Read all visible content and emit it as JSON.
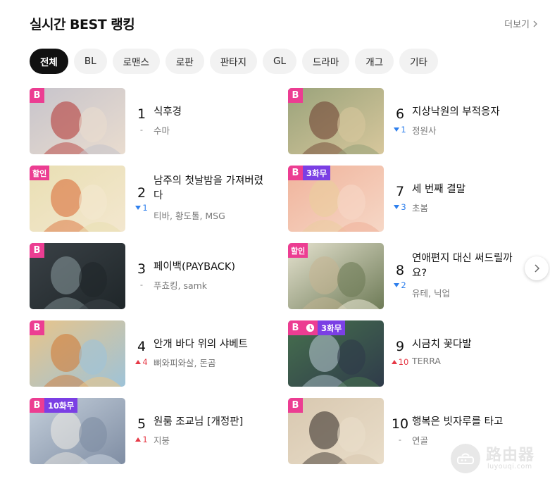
{
  "header": {
    "title": "실시간 BEST 랭킹",
    "more_label": "더보기"
  },
  "tabs": [
    "전체",
    "BL",
    "로맨스",
    "로판",
    "판타지",
    "GL",
    "드라마",
    "개그",
    "기타"
  ],
  "ranking": [
    {
      "rank": "1",
      "title_l1": "식후경",
      "title_l2": "",
      "authors": "수마",
      "change_dir": "same",
      "change": "-",
      "badges": [
        "B"
      ],
      "colors": [
        "#c7c4cb",
        "#b3302e",
        "#e9dccf"
      ]
    },
    {
      "rank": "2",
      "title_l1": "남주의 첫날밤을 가져버렸",
      "title_l2": "다",
      "authors": "티바, 황도톨, MSG",
      "change_dir": "down",
      "change": "1",
      "badges": [
        "할인"
      ],
      "colors": [
        "#e9dfb3",
        "#d9652e",
        "#f3e7cf"
      ]
    },
    {
      "rank": "3",
      "title_l1": "페이백(PAYBACK)",
      "title_l2": "",
      "authors": "푸쵸킹, samk",
      "change_dir": "same",
      "change": "-",
      "badges": [
        "B"
      ],
      "colors": [
        "#3a4146",
        "#8a9b9e",
        "#1f2629"
      ]
    },
    {
      "rank": "4",
      "title_l1": "안개 바다 위의 샤베트",
      "title_l2": "",
      "authors": "뼈와피와살, 돈곰",
      "change_dir": "up",
      "change": "4",
      "badges": [
        "B"
      ],
      "colors": [
        "#e8c48a",
        "#d27630",
        "#9ec3d8"
      ]
    },
    {
      "rank": "5",
      "title_l1": "원룸 조교님 [개정판]",
      "title_l2": "",
      "authors": "지붕",
      "change_dir": "up",
      "change": "1",
      "badges": [
        "B",
        "10화무"
      ],
      "colors": [
        "#c4cfdb",
        "#f1ede5",
        "#7f8da3"
      ]
    },
    {
      "rank": "6",
      "title_l1": "지상낙원의 부적응자",
      "title_l2": "",
      "authors": "정원사",
      "change_dir": "down",
      "change": "1",
      "badges": [
        "B"
      ],
      "colors": [
        "#9aa37b",
        "#6b3b2d",
        "#d7c79c"
      ]
    },
    {
      "rank": "7",
      "title_l1": "세 번째 결말",
      "title_l2": "",
      "authors": "초봄",
      "change_dir": "down",
      "change": "3",
      "badges": [
        "B",
        "3화무"
      ],
      "colors": [
        "#f0b39b",
        "#e9cf9b",
        "#f6d7c6"
      ]
    },
    {
      "rank": "8",
      "title_l1": "연애편지 대신 써드릴까",
      "title_l2": "요?",
      "authors": "유테, 닉업",
      "change_dir": "down",
      "change": "2",
      "badges": [
        "할인"
      ],
      "colors": [
        "#e5e2cf",
        "#c7b592",
        "#6e7b57"
      ]
    },
    {
      "rank": "9",
      "title_l1": "시금치 꽃다발",
      "title_l2": "",
      "authors": "TERRA",
      "change_dir": "up",
      "change": "10",
      "badges": [
        "B",
        "clock",
        "3화무"
      ],
      "colors": [
        "#46704e",
        "#b9cbd6",
        "#2f3b4a"
      ]
    },
    {
      "rank": "10",
      "title_l1": "행복은 빗자루를 타고",
      "title_l2": "",
      "authors": "연골",
      "change_dir": "same",
      "change": "-",
      "badges": [
        "B"
      ],
      "colors": [
        "#d8c8b0",
        "#2c2521",
        "#e9ddc9"
      ]
    }
  ],
  "watermark": {
    "text_big": "路由器",
    "text_small": "luyouqi.com"
  },
  "icons": {
    "more": "chevron-right-icon",
    "next": "chevron-right-icon",
    "clock": "clock-icon"
  },
  "accent": {
    "pink": "#ec3d92",
    "purple": "#7b3fe4",
    "up": "#e63946",
    "down": "#2f80ed"
  }
}
